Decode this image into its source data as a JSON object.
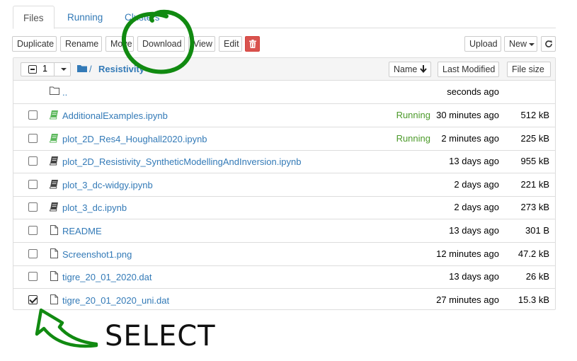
{
  "tabs": [
    "Files",
    "Running",
    "Clusters"
  ],
  "toolbar": {
    "duplicate": "Duplicate",
    "rename": "Rename",
    "move": "Move",
    "download": "Download",
    "view": "View",
    "edit": "Edit",
    "delete_icon": "trash-icon",
    "upload": "Upload",
    "new": "New",
    "refresh_icon": "refresh-icon"
  },
  "list_header": {
    "selected_count": "1",
    "breadcrumb_sep": "/",
    "folder": "Resistivity",
    "sort_name": "Name",
    "sort_modified": "Last Modified",
    "sort_size": "File size"
  },
  "parent_row": {
    "name": "..",
    "modified": "seconds ago"
  },
  "files": [
    {
      "name": "AdditionalExamples.ipynb",
      "icon": "notebook-running",
      "running": "Running",
      "modified": "30 minutes ago",
      "size": "512 kB",
      "checked": false
    },
    {
      "name": "plot_2D_Res4_Houghall2020.ipynb",
      "icon": "notebook-running",
      "running": "Running",
      "modified": "2 minutes ago",
      "size": "225 kB",
      "checked": false
    },
    {
      "name": "plot_2D_Resistivity_SyntheticModellingAndInversion.ipynb",
      "icon": "notebook",
      "running": "",
      "modified": "13 days ago",
      "size": "955 kB",
      "checked": false
    },
    {
      "name": "plot_3_dc-widgy.ipynb",
      "icon": "notebook",
      "running": "",
      "modified": "2 days ago",
      "size": "221 kB",
      "checked": false
    },
    {
      "name": "plot_3_dc.ipynb",
      "icon": "notebook",
      "running": "",
      "modified": "2 days ago",
      "size": "273 kB",
      "checked": false
    },
    {
      "name": "README",
      "icon": "file",
      "running": "",
      "modified": "13 days ago",
      "size": "301 B",
      "checked": false
    },
    {
      "name": "Screenshot1.png",
      "icon": "file",
      "running": "",
      "modified": "12 minutes ago",
      "size": "47.2 kB",
      "checked": false
    },
    {
      "name": "tigre_20_01_2020.dat",
      "icon": "file",
      "running": "",
      "modified": "13 days ago",
      "size": "26 kB",
      "checked": false
    },
    {
      "name": "tigre_20_01_2020_uni.dat",
      "icon": "file",
      "running": "",
      "modified": "27 minutes ago",
      "size": "15.3 kB",
      "checked": true
    }
  ],
  "annotation": {
    "text": "SELECT",
    "color": "#118a11"
  }
}
